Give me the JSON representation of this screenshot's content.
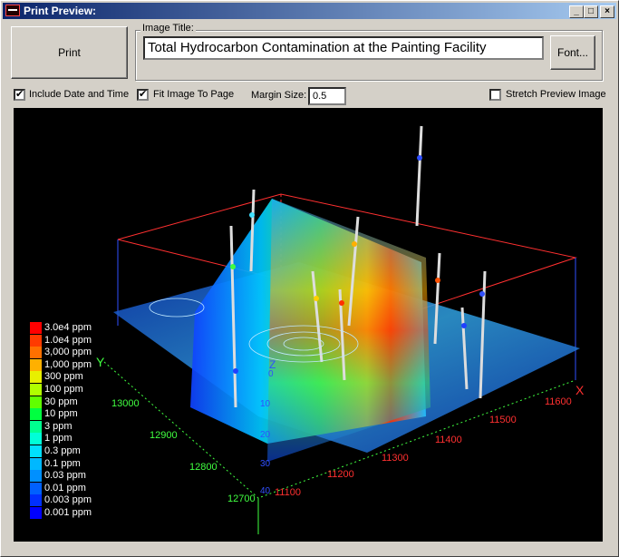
{
  "window": {
    "title": "Print Preview:"
  },
  "toolbar": {
    "print_label": "Print",
    "image_title_label": "Image Title:",
    "image_title_value": "Total Hydrocarbon Contamination at the Painting Facility",
    "font_label": "Font..."
  },
  "options": {
    "include_date": {
      "label": "Include Date and Time",
      "checked": true,
      "mark": "✔"
    },
    "fit_image": {
      "label": "Fit Image To Page",
      "checked": true,
      "mark": "✔"
    },
    "margin_label": "Margin Size:",
    "margin_value": "0.5",
    "stretch": {
      "label": "Stretch Preview Image",
      "checked": false,
      "mark": ""
    }
  },
  "preview": {
    "axis_labels": {
      "x": "X",
      "y": "Y",
      "z": "Z"
    },
    "x_ticks": [
      "11100",
      "11200",
      "11300",
      "11400",
      "11500",
      "11600"
    ],
    "y_ticks": [
      "12700",
      "12800",
      "12900",
      "13000"
    ],
    "z_ticks": [
      "0",
      "10",
      "20",
      "30",
      "40"
    ],
    "legend": [
      {
        "label": "3.0e4 ppm",
        "color": "#ff0000"
      },
      {
        "label": "1.0e4 ppm",
        "color": "#ff3a00"
      },
      {
        "label": "3,000 ppm",
        "color": "#ff7000"
      },
      {
        "label": "1,000 ppm",
        "color": "#ffb000"
      },
      {
        "label": "300 ppm",
        "color": "#e8f000"
      },
      {
        "label": "100 ppm",
        "color": "#b0ff00"
      },
      {
        "label": "30 ppm",
        "color": "#60ff00"
      },
      {
        "label": "10 ppm",
        "color": "#00ff40"
      },
      {
        "label": "3 ppm",
        "color": "#00ff90"
      },
      {
        "label": "1 ppm",
        "color": "#00ffd8"
      },
      {
        "label": "0.3 ppm",
        "color": "#00e0ff"
      },
      {
        "label": "0.1 ppm",
        "color": "#00b8ff"
      },
      {
        "label": "0.03 ppm",
        "color": "#0090ff"
      },
      {
        "label": "0.01 ppm",
        "color": "#0060ff"
      },
      {
        "label": "0.003 ppm",
        "color": "#0030ff"
      },
      {
        "label": "0.001 ppm",
        "color": "#0000ff"
      }
    ]
  }
}
